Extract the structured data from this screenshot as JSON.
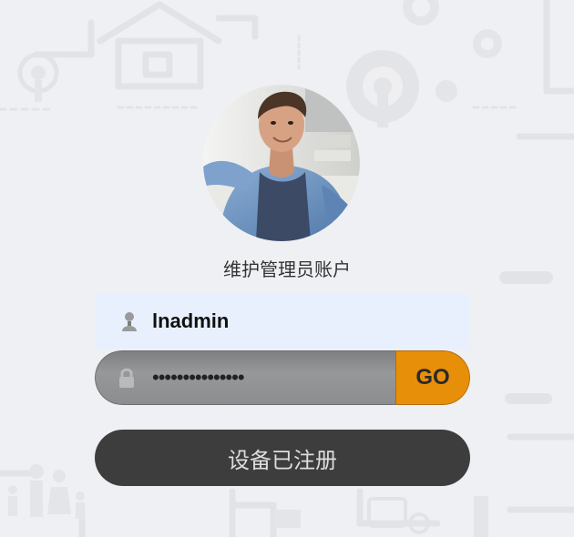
{
  "account": {
    "title": "维护管理员账户",
    "avatar_alt": "administrator avatar"
  },
  "login": {
    "username": "lnadmin",
    "password_masked": "•••••••••••••••",
    "go_label": "GO"
  },
  "register": {
    "label": "设备已注册"
  },
  "colors": {
    "background": "#eff0f3",
    "username_bg": "#e8f0fe",
    "go_button": "#e88f0a",
    "register_button": "#3d3d3d"
  },
  "icons": {
    "user": "user-icon",
    "lock": "lock-icon"
  }
}
